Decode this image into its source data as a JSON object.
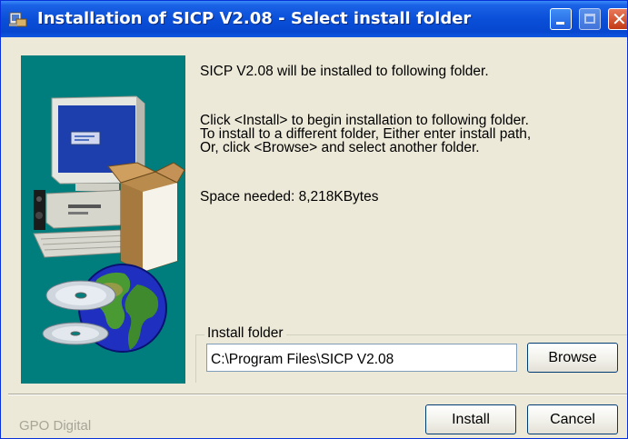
{
  "window": {
    "title": "Installation of SICP V2.08 - Select install folder",
    "icons": {
      "app": "installer-icon",
      "minimize": "minimize-icon",
      "maximize": "maximize-icon",
      "close": "close-icon"
    }
  },
  "colors": {
    "titlebar": "#0A4FD8",
    "panel_bg": "#007E7E",
    "dialog_bg": "#ECE9D8"
  },
  "messages": {
    "line1": "SICP V2.08 will be installed to following folder.",
    "line2": "Click <Install> to begin installation to following folder.\nTo install to a different folder, Either enter install path,\nOr, click <Browse> and select another folder.",
    "space": "Space needed: 8,218KBytes"
  },
  "install_folder": {
    "label": "Install folder",
    "value": "C:\\Program Files\\SICP V2.08",
    "browse_label": "Browse"
  },
  "footer": {
    "brand": "GPO Digital",
    "install_label": "Install",
    "cancel_label": "Cancel"
  }
}
